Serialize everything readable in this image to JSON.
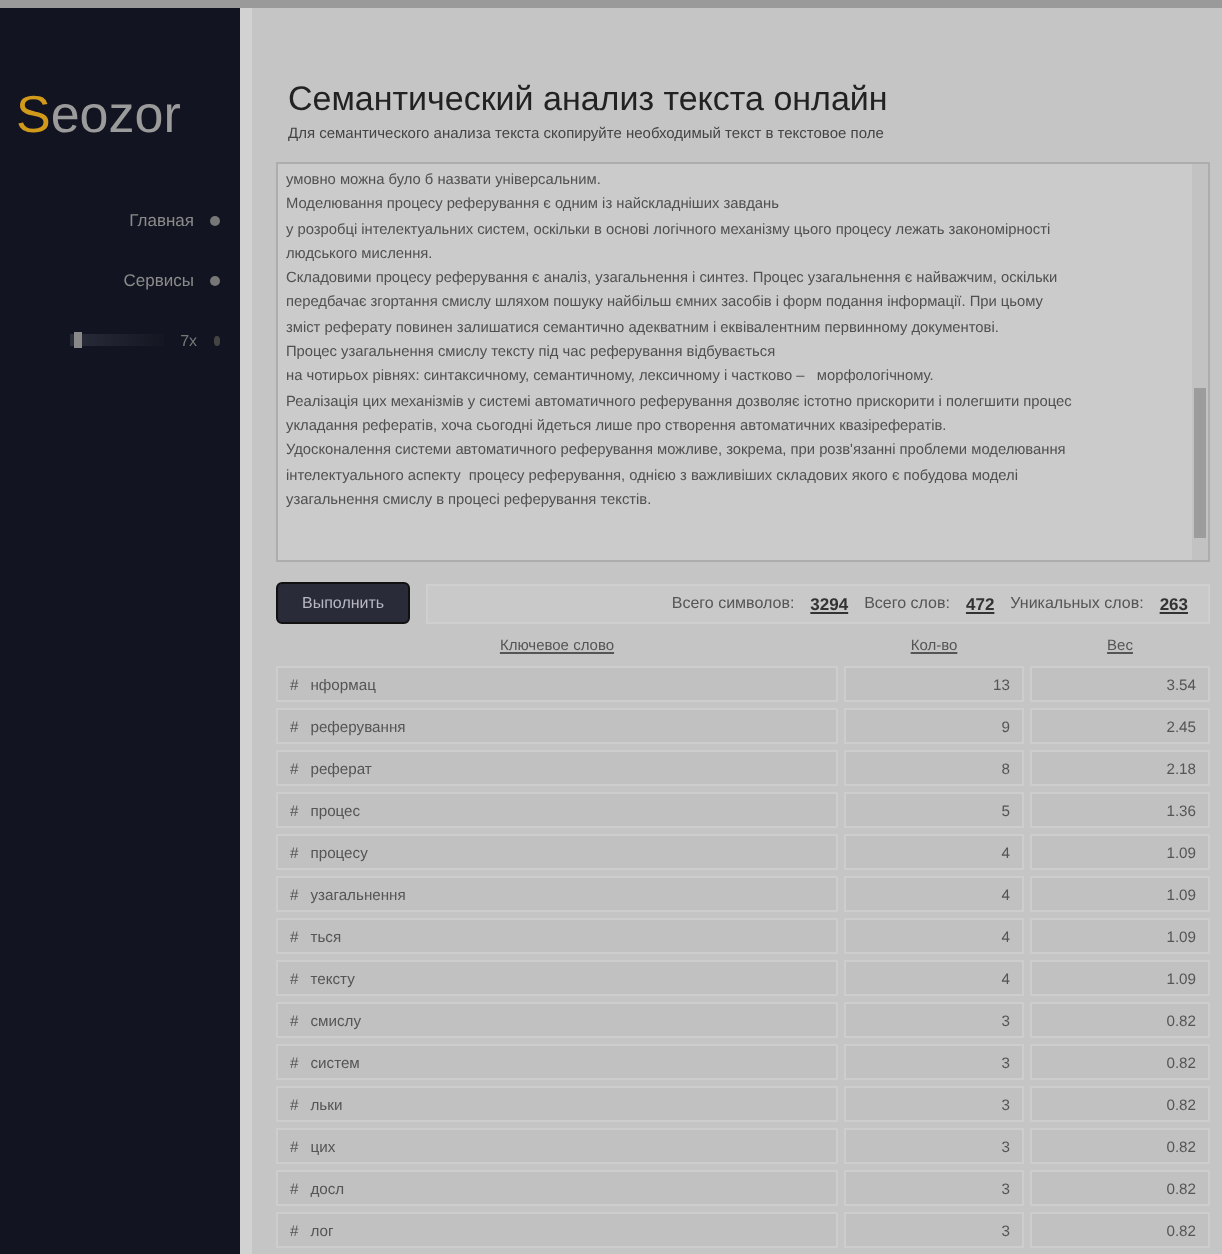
{
  "sidebar": {
    "logo": {
      "initial": "S",
      "rest": "eozor"
    },
    "nav": [
      {
        "label": "Главная"
      },
      {
        "label": "Сервисы"
      }
    ],
    "slider": {
      "level": 0.05,
      "reading": "7x"
    }
  },
  "header": {
    "title": "Семантический анализ текста онлайн",
    "subtitle": "Для семантического анализа текста скопируйте необходимый текст в текстовое поле"
  },
  "text_field": {
    "value": "умовно можна було б назвати універсальним.\nМоделювання процесу реферування є одним із найскладніших завдань\nу розробці інтелектуальних систем, оскільки в основі логічного механізму цього процесу лежать закономірності\nлюдського мислення.\nСкладовими процесу реферування є аналіз, узагальнення і синтез. Процес узагальнення є найважчим, оскільки\nпередбачає згортання смислу шляхом пошуку найбільш ємних засобів і форм подання інформації. При цьому\nзміст реферату повинен залишатися семантично адекватним і еквівалентним первинному документові.\nПроцес узагальнення смислу тексту під час реферування відбувається\nна чотирьох рівнях: синтаксичному, семантичному, лексичному і частково –   морфологічному.\nРеалізація цих механізмів у системі автоматичного реферування дозволяє істотно прискорити і полегшити процес\nукладання рефератів, хоча сьогодні йдеться лише про створення автоматичних квазірефератів.\nУдосконалення системи автоматичного реферування можливе, зокрема, при розв'язанні проблеми моделювання\nінтелектуального аспекту  процесу реферування, однією з важливіших складових якого є побудова моделі\nузагальнення смислу в процесі реферування текстів."
  },
  "run_button": "Выполнить",
  "stats": [
    {
      "label": "Всего символов:",
      "value": "3294"
    },
    {
      "label": "Всего слов:",
      "value": "472"
    },
    {
      "label": "Уникальных слов:",
      "value": "263"
    }
  ],
  "table": {
    "columns": [
      "Ключевое слово",
      "Кол-во",
      "Вес"
    ],
    "rows": [
      {
        "mark": "#",
        "word": "нформац",
        "count": "13",
        "weight": "3.54"
      },
      {
        "mark": "#",
        "word": "реферування",
        "count": "9",
        "weight": "2.45"
      },
      {
        "mark": "#",
        "word": "реферат",
        "count": "8",
        "weight": "2.18"
      },
      {
        "mark": "#",
        "word": "процес",
        "count": "5",
        "weight": "1.36"
      },
      {
        "mark": "#",
        "word": "процесу",
        "count": "4",
        "weight": "1.09"
      },
      {
        "mark": "#",
        "word": "узагальнення",
        "count": "4",
        "weight": "1.09"
      },
      {
        "mark": "#",
        "word": "ться",
        "count": "4",
        "weight": "1.09"
      },
      {
        "mark": "#",
        "word": "тексту",
        "count": "4",
        "weight": "1.09"
      },
      {
        "mark": "#",
        "word": "смислу",
        "count": "3",
        "weight": "0.82"
      },
      {
        "mark": "#",
        "word": "систем",
        "count": "3",
        "weight": "0.82"
      },
      {
        "mark": "#",
        "word": "льки",
        "count": "3",
        "weight": "0.82"
      },
      {
        "mark": "#",
        "word": "цих",
        "count": "3",
        "weight": "0.82"
      },
      {
        "mark": "#",
        "word": "досл",
        "count": "3",
        "weight": "0.82"
      },
      {
        "mark": "#",
        "word": "лог",
        "count": "3",
        "weight": "0.82"
      }
    ]
  }
}
